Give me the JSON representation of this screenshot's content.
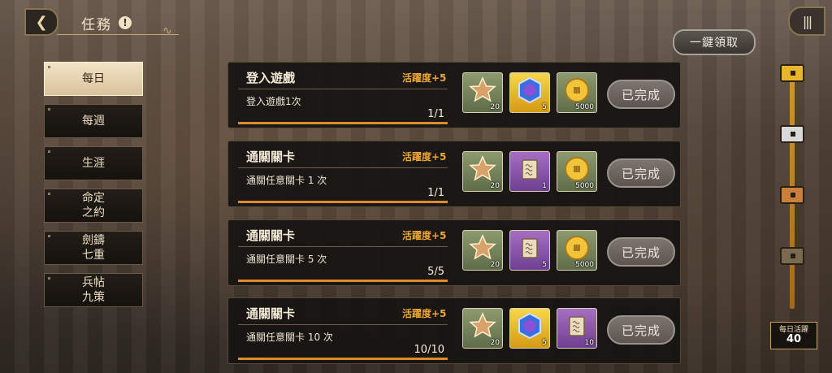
{
  "header": {
    "title": "任務",
    "info": "!",
    "menu": "|||"
  },
  "claim_all_label": "一鍵領取",
  "sidebar": {
    "items": [
      {
        "label": "每日",
        "active": true
      },
      {
        "label": "每週",
        "active": false
      },
      {
        "label": "生涯",
        "active": false
      },
      {
        "label": "命定\n之約",
        "active": false
      },
      {
        "label": "劍鑄\n七重",
        "active": false
      },
      {
        "label": "兵帖\n九策",
        "active": false
      }
    ]
  },
  "tasks": [
    {
      "name": "登入遊戲",
      "activity": "活躍度+5",
      "desc": "登入遊戲1次",
      "progress_text": "1/1",
      "progress": 1.0,
      "rewards": [
        {
          "icon": "star-medal-icon",
          "bg": "green",
          "qty": "20"
        },
        {
          "icon": "blue-gem-icon",
          "bg": "gold",
          "qty": "5"
        },
        {
          "icon": "gold-coin-icon",
          "bg": "green",
          "qty": "5000"
        }
      ],
      "button": "已完成"
    },
    {
      "name": "通關關卡",
      "activity": "活躍度+5",
      "desc": "通關任意關卡 1 次",
      "progress_text": "1/1",
      "progress": 1.0,
      "rewards": [
        {
          "icon": "star-medal-icon",
          "bg": "green",
          "qty": "20"
        },
        {
          "icon": "scroll-icon",
          "bg": "purple",
          "qty": "1"
        },
        {
          "icon": "gold-coin-icon",
          "bg": "green",
          "qty": "5000"
        }
      ],
      "button": "已完成"
    },
    {
      "name": "通關關卡",
      "activity": "活躍度+5",
      "desc": "通關任意關卡 5 次",
      "progress_text": "5/5",
      "progress": 1.0,
      "rewards": [
        {
          "icon": "star-medal-icon",
          "bg": "green",
          "qty": "20"
        },
        {
          "icon": "scroll-icon",
          "bg": "purple",
          "qty": "5"
        },
        {
          "icon": "gold-coin-icon",
          "bg": "green",
          "qty": "5000"
        }
      ],
      "button": "已完成"
    },
    {
      "name": "通關關卡",
      "activity": "活躍度+5",
      "desc": "通關任意關卡 10 次",
      "progress_text": "10/10",
      "progress": 1.0,
      "rewards": [
        {
          "icon": "star-medal-icon",
          "bg": "green",
          "qty": "20"
        },
        {
          "icon": "blue-gem-icon",
          "bg": "gold",
          "qty": "5"
        },
        {
          "icon": "scroll-icon",
          "bg": "purple",
          "qty": "10"
        }
      ],
      "button": "已完成"
    }
  ],
  "daily_activity": {
    "label": "每日活躍",
    "value": "40",
    "chests": [
      {
        "icon": "gold-chest-icon",
        "color": "#e8b52c"
      },
      {
        "icon": "silver-chest-icon",
        "color": "#d9d9d9"
      },
      {
        "icon": "bronze-chest-icon",
        "color": "#c9803a"
      },
      {
        "icon": "dark-chest-icon",
        "color": "#7a6a52"
      }
    ]
  },
  "colors": {
    "accent": "#f0a736",
    "progress": "#e08a2e"
  }
}
